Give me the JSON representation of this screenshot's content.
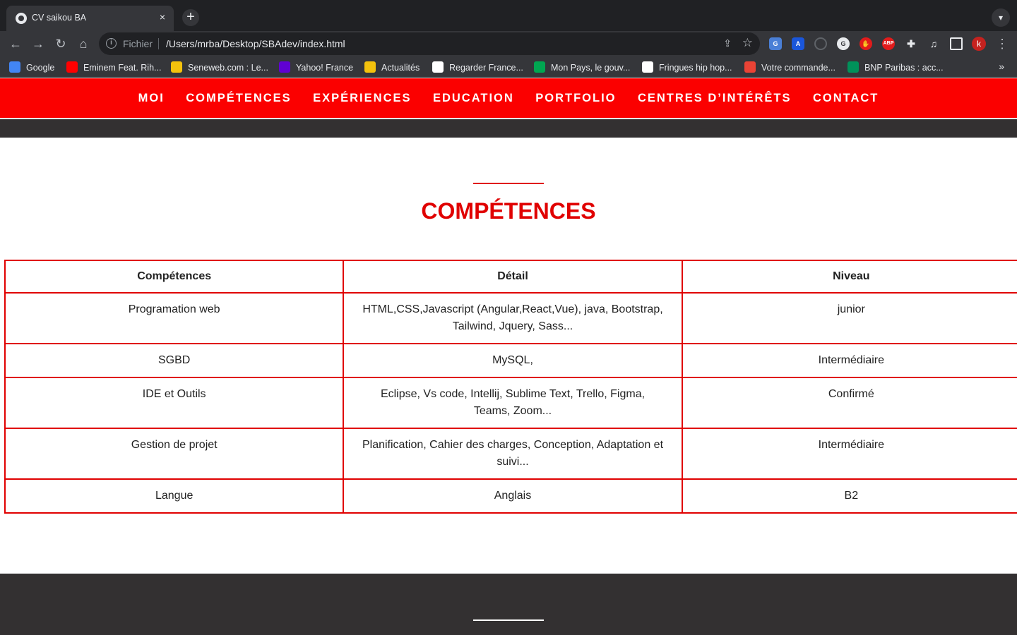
{
  "browser": {
    "tab_title": "CV saikou BA",
    "tab_close": "×",
    "new_tab": "+",
    "address_scheme": "Fichier",
    "address_url": "/Users/mrba/Desktop/SBAdev/index.html",
    "profile_initial": "k",
    "bookmarks": [
      {
        "label": "Google",
        "icon_color": "#4285f4"
      },
      {
        "label": "Eminem Feat. Rih...",
        "icon_color": "#ff0000"
      },
      {
        "label": "Seneweb.com : Le...",
        "icon_color": "#f4c20d"
      },
      {
        "label": "Yahoo! France",
        "icon_color": "#6001d2"
      },
      {
        "label": "Actualités",
        "icon_color": "#f4c20d"
      },
      {
        "label": "Regarder France...",
        "icon_color": "#ffffff"
      },
      {
        "label": "Mon Pays, le gouv...",
        "icon_color": "#00a651"
      },
      {
        "label": "Fringues hip hop...",
        "icon_color": "#ffffff"
      },
      {
        "label": "Votre commande...",
        "icon_color": "#ea4335"
      },
      {
        "label": "BNP Paribas : acc...",
        "icon_color": "#00915a"
      }
    ],
    "bookmarks_more": "»"
  },
  "site": {
    "accent": "#fb0000",
    "nav": [
      "MOI",
      "COMPÉTENCES",
      "EXPÉRIENCES",
      "EDUCATION",
      "PORTFOLIO",
      "CENTRES D’INTÉRÊTS",
      "CONTACT"
    ],
    "section_title": "COMPÉTENCES",
    "table": {
      "headers": [
        "Compétences",
        "Détail",
        "Niveau"
      ],
      "rows": [
        [
          "Programation web",
          "HTML,CSS,Javascript (Angular,React,Vue), java, Bootstrap, Tailwind, Jquery, Sass...",
          "junior"
        ],
        [
          "SGBD",
          "MySQL,",
          "Intermédiaire"
        ],
        [
          "IDE et Outils",
          "Eclipse, Vs code, Intellij, Sublime Text, Trello, Figma, Teams, Zoom...",
          "Confirmé"
        ],
        [
          "Gestion de projet",
          "Planification, Cahier des charges, Conception, Adaptation et suivi...",
          "Intermédiaire"
        ],
        [
          "Langue",
          "Anglais",
          "B2"
        ]
      ]
    }
  }
}
